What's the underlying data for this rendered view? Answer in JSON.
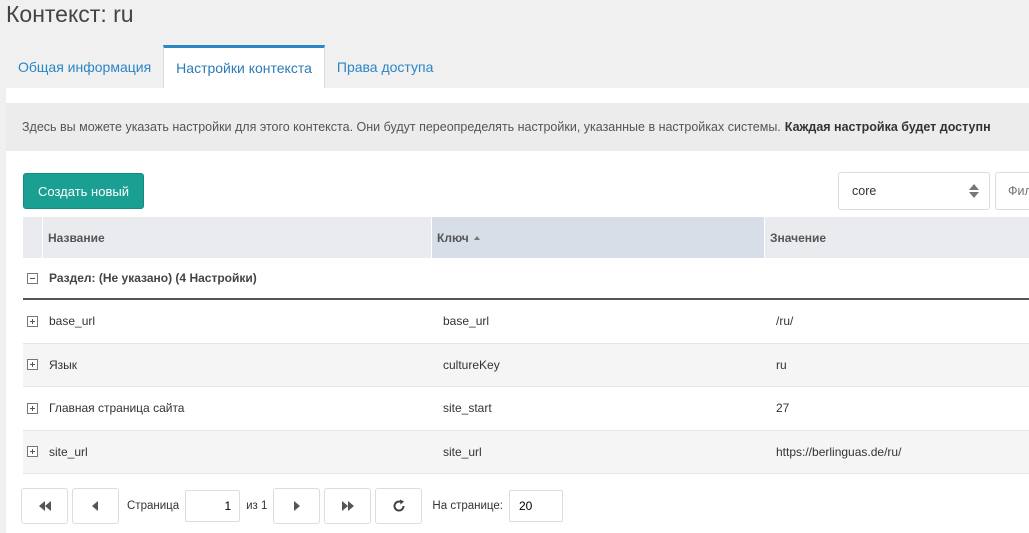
{
  "page": {
    "title": "Контекст: ru"
  },
  "tabs": [
    {
      "label": "Общая информация",
      "active": false
    },
    {
      "label": "Настройки контекста",
      "active": true
    },
    {
      "label": "Права доступа",
      "active": false
    }
  ],
  "description": {
    "text": "Здесь вы можете указать настройки для этого контекста. Они будут переопределять настройки, указанные в настройках системы.",
    "bold": "Каждая настройка будет доступн"
  },
  "toolbar": {
    "create_label": "Создать новый",
    "namespace_value": "core",
    "filter_placeholder": "Фил"
  },
  "grid": {
    "columns": {
      "name": "Название",
      "key": "Ключ",
      "value": "Значение"
    },
    "group_label": "Раздел: (Не указано) (4 Настройки)",
    "rows": [
      {
        "name": "base_url",
        "key": "base_url",
        "value": "/ru/"
      },
      {
        "name": "Язык",
        "key": "cultureKey",
        "value": "ru"
      },
      {
        "name": "Главная страница сайта",
        "key": "site_start",
        "value": "27"
      },
      {
        "name": "site_url",
        "key": "site_url",
        "value": "https://berlinguas.de/ru/"
      }
    ]
  },
  "pager": {
    "page_label": "Страница",
    "page_value": "1",
    "of_label": "из 1",
    "per_page_label": "На странице:",
    "per_page_value": "20"
  },
  "colors": {
    "accent": "#2b86c5",
    "create_button": "#1a9f93"
  }
}
